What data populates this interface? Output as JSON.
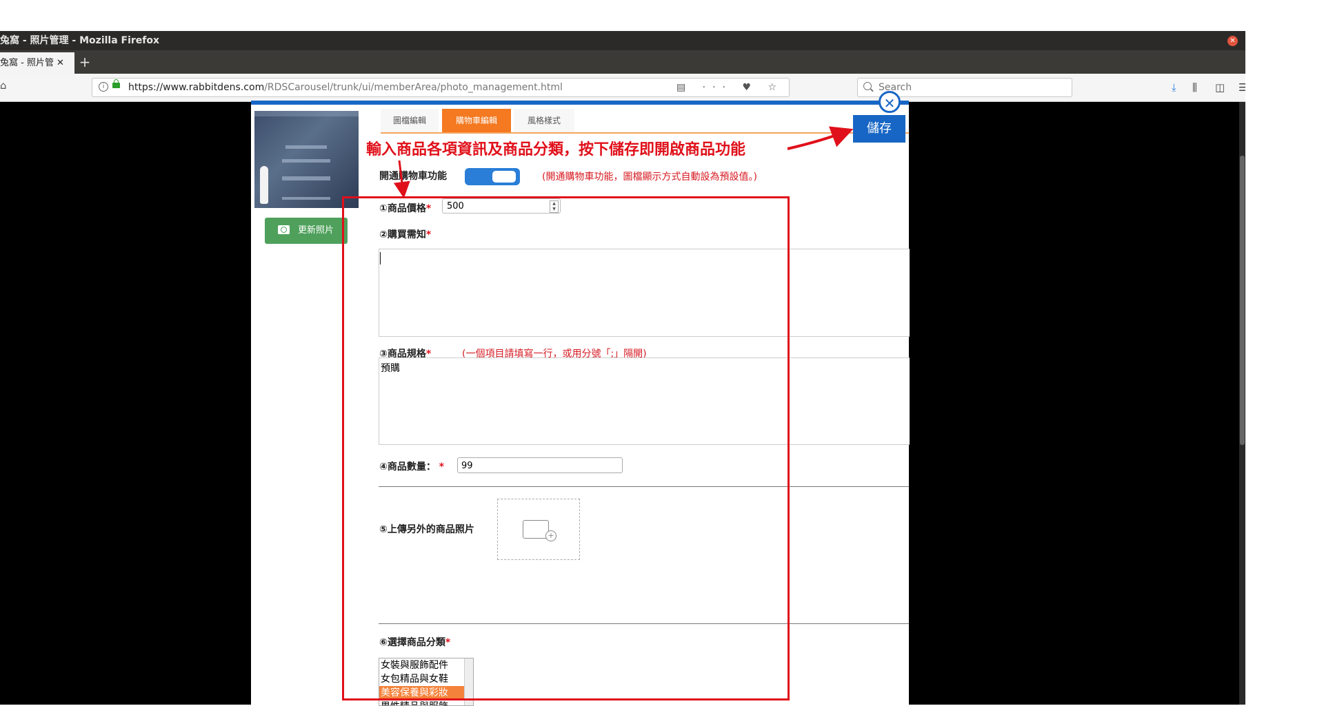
{
  "window": {
    "title": "兔窩 - 照片管理 - Mozilla Firefox"
  },
  "browser": {
    "tab_label": "兔窩 - 照片管",
    "tab_close": "✕",
    "new_tab": "+",
    "url_domain": "https://www.rabbitdens.com",
    "url_path": "/RDSCarousel/trunk/ui/memberArea/photo_management.html",
    "page_tools": "▤ ··· ♥ ☆",
    "search_placeholder": "Search"
  },
  "sidebar": {
    "update_photo": "更新照片"
  },
  "tabs": [
    {
      "label": "圖檔編輯"
    },
    {
      "label": "購物車編輯"
    },
    {
      "label": "風格樣式"
    }
  ],
  "toolbar": {
    "save": "儲存"
  },
  "annotation": "輸入商品各項資訊及商品分類，按下儲存即開啟商品功能",
  "cart": {
    "enable_label": "開通購物車功能",
    "enabled": true,
    "enable_note": "(開通購物車功能，圖檔顯示方式自動設為預設值。)"
  },
  "form": {
    "price_label": "①商品價格",
    "price_value": "500",
    "notice_label": "②購買需知",
    "notice_value": "",
    "spec_label": "③商品規格",
    "spec_note": "(一個項目請填寫一行，或用分號「;」隔開)",
    "spec_value": "預購",
    "qty_label": "④商品數量：",
    "qty_value": "99",
    "upload_label": "⑤上傳另外的商品照片",
    "category_label": "⑥選擇商品分類",
    "required_mark": "*",
    "categories": [
      "女裝與服飾配件",
      "女包精品與女鞋",
      "美容保養與彩妝",
      "男性精品與服飾"
    ],
    "selected_category": "美容保養與彩妝"
  },
  "colors": {
    "accent": "#1766c5",
    "tab_active": "#f47920",
    "success": "#4ea05b",
    "annotation": "#e0101a"
  }
}
